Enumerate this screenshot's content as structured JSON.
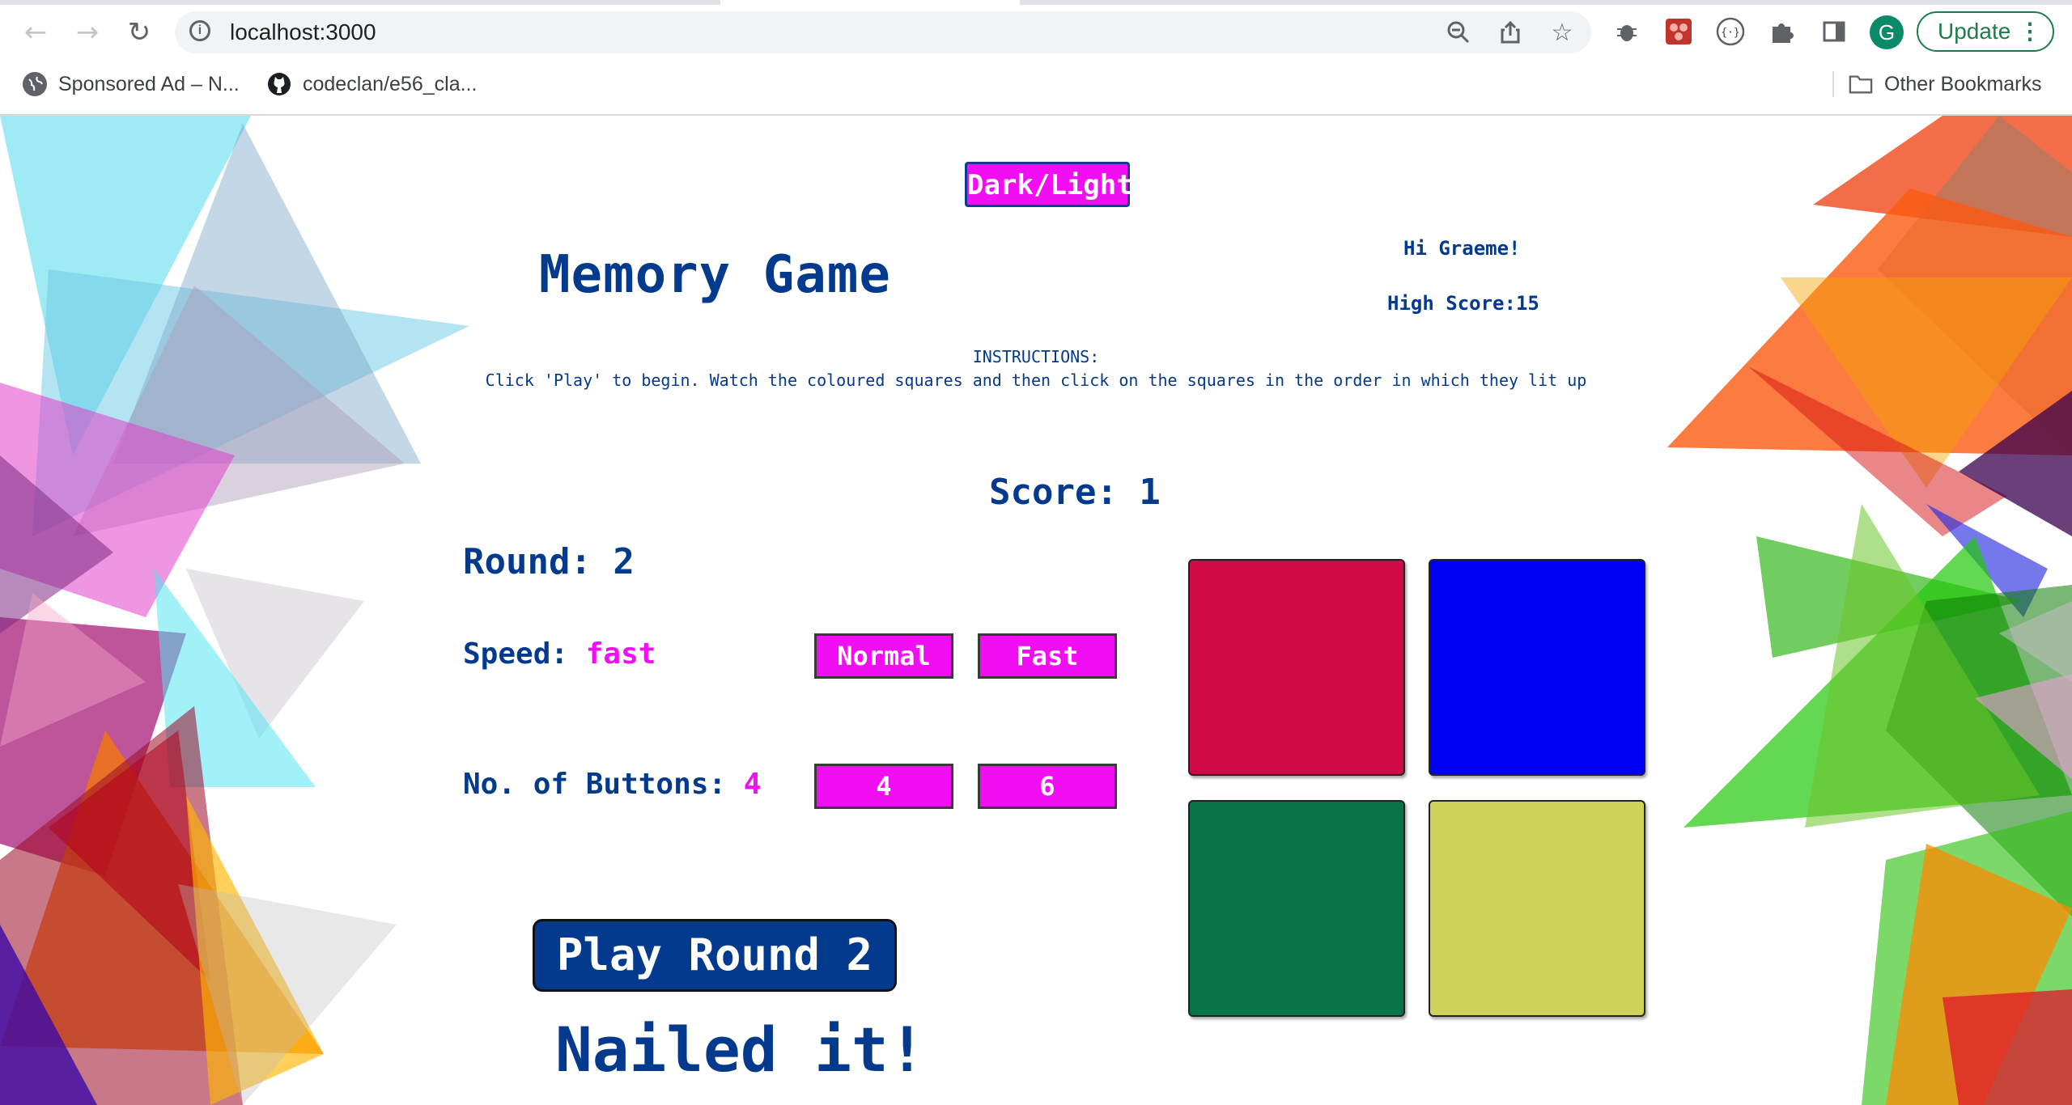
{
  "browser": {
    "url": "localhost:3000",
    "avatar_letter": "G",
    "update_label": "Update",
    "update_menu_glyph": "⋮",
    "bookmarks": [
      {
        "label": "Sponsored Ad – N...",
        "icon": "globe-icon"
      },
      {
        "label": "codeclan/e56_cla...",
        "icon": "github-icon"
      }
    ],
    "other_bookmarks_label": "Other Bookmarks"
  },
  "app": {
    "theme_toggle_label": "Dark/Light",
    "title": "Memory Game",
    "greeting": "Hi Graeme!",
    "high_score_label": "High Score:15",
    "instructions_heading": "INSTRUCTIONS:",
    "instructions_text": "Click 'Play' to begin. Watch the coloured squares and then click on the squares in the order in which they lit up",
    "score_label": "Score: 1",
    "round_label": "Round: 2",
    "speed_label": "Speed: ",
    "speed_value": "fast",
    "speed_options": [
      "Normal",
      "Fast"
    ],
    "buttons_label": "No. of Buttons: ",
    "buttons_value": "4",
    "buttons_options": [
      "4",
      "6"
    ],
    "play_button_label": "Play Round 2",
    "result_message": "Nailed it!",
    "squares": [
      {
        "name": "red",
        "color": "#d00a47"
      },
      {
        "name": "blue",
        "color": "#0000f5"
      },
      {
        "name": "green",
        "color": "#077346"
      },
      {
        "name": "yellow",
        "color": "#ced45a"
      }
    ]
  },
  "colors": {
    "accent": "#f20ef2",
    "text_primary": "#043a8e",
    "play_button": "#043a8e"
  }
}
